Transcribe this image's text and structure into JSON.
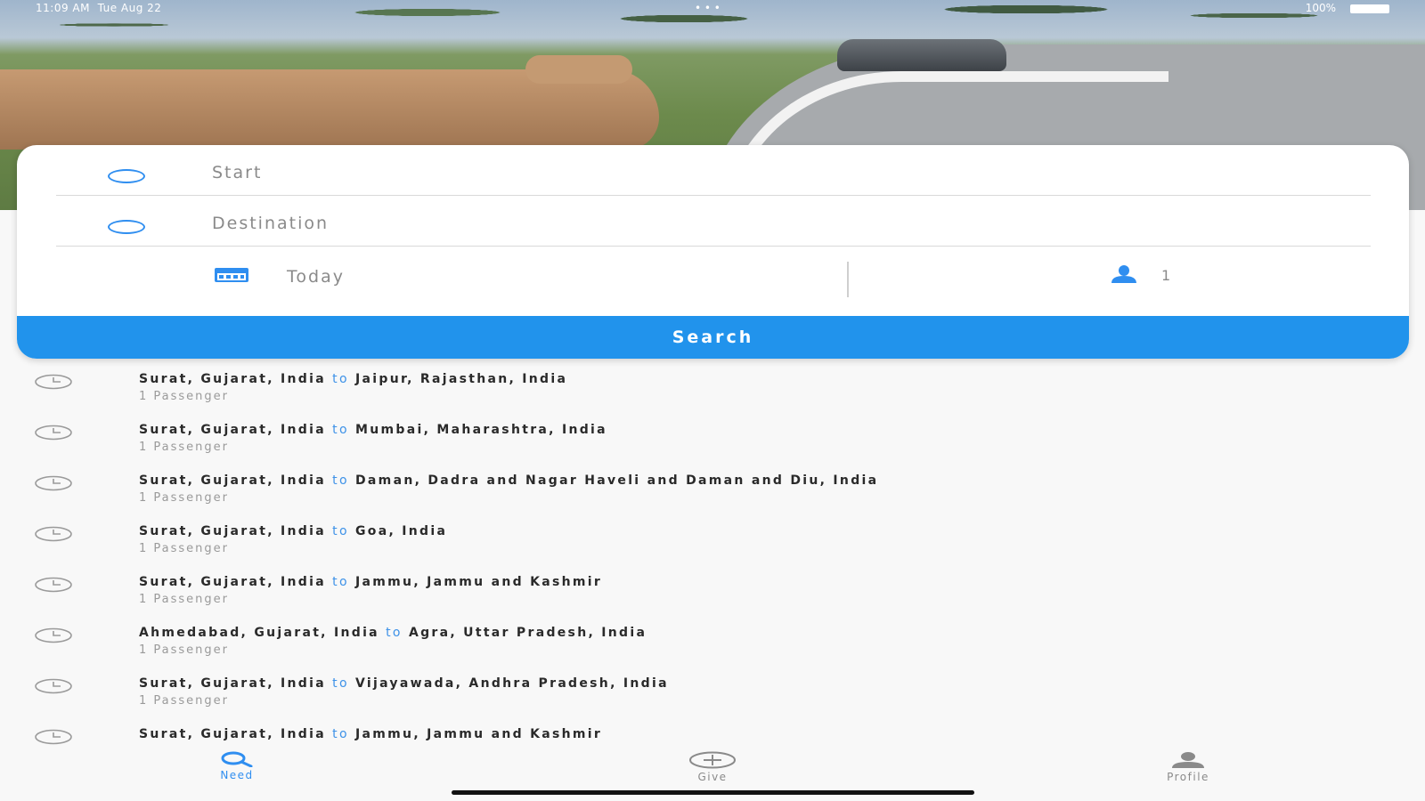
{
  "status_bar": {
    "time": "11:09 AM",
    "date": "Tue Aug 22",
    "center": "• • •",
    "battery": "100%"
  },
  "search": {
    "start_placeholder": "Start",
    "destination_placeholder": "Destination",
    "date_label": "Today",
    "passenger_count": "1",
    "search_label": "Search"
  },
  "recent": [
    {
      "from": "Surat, Gujarat, India",
      "to_word": "to",
      "to": "Jaipur, Rajasthan, India",
      "passengers": "1 Passenger"
    },
    {
      "from": "Surat, Gujarat, India",
      "to_word": "to",
      "to": "Mumbai, Maharashtra, India",
      "passengers": "1 Passenger"
    },
    {
      "from": "Surat, Gujarat, India",
      "to_word": "to",
      "to": "Daman, Dadra and Nagar Haveli and Daman and Diu, India",
      "passengers": "1 Passenger"
    },
    {
      "from": "Surat, Gujarat, India",
      "to_word": "to",
      "to": "Goa, India",
      "passengers": "1 Passenger"
    },
    {
      "from": "Surat, Gujarat, India",
      "to_word": "to",
      "to": "Jammu, Jammu and Kashmir",
      "passengers": "1 Passenger"
    },
    {
      "from": "Ahmedabad, Gujarat, India",
      "to_word": "to",
      "to": "Agra, Uttar Pradesh, India",
      "passengers": "1 Passenger"
    },
    {
      "from": "Surat, Gujarat, India",
      "to_word": "to",
      "to": "Vijayawada, Andhra Pradesh, India",
      "passengers": "1 Passenger"
    },
    {
      "from": "Surat, Gujarat, India",
      "to_word": "to",
      "to": "Jammu, Jammu and Kashmir",
      "passengers": ""
    }
  ],
  "tabs": {
    "need": "Need",
    "give": "Give",
    "profile": "Profile"
  },
  "colors": {
    "accent": "#2193ec",
    "to_word": "#3e92e8",
    "inactive": "#8a8a8a"
  },
  "icons": {
    "start": "ring-icon",
    "destination": "ring-icon",
    "date": "calendar-icon",
    "passengers": "person-icon",
    "recent": "clock-icon",
    "need": "search-icon",
    "give": "plus-circle-icon",
    "profile": "person-icon"
  }
}
